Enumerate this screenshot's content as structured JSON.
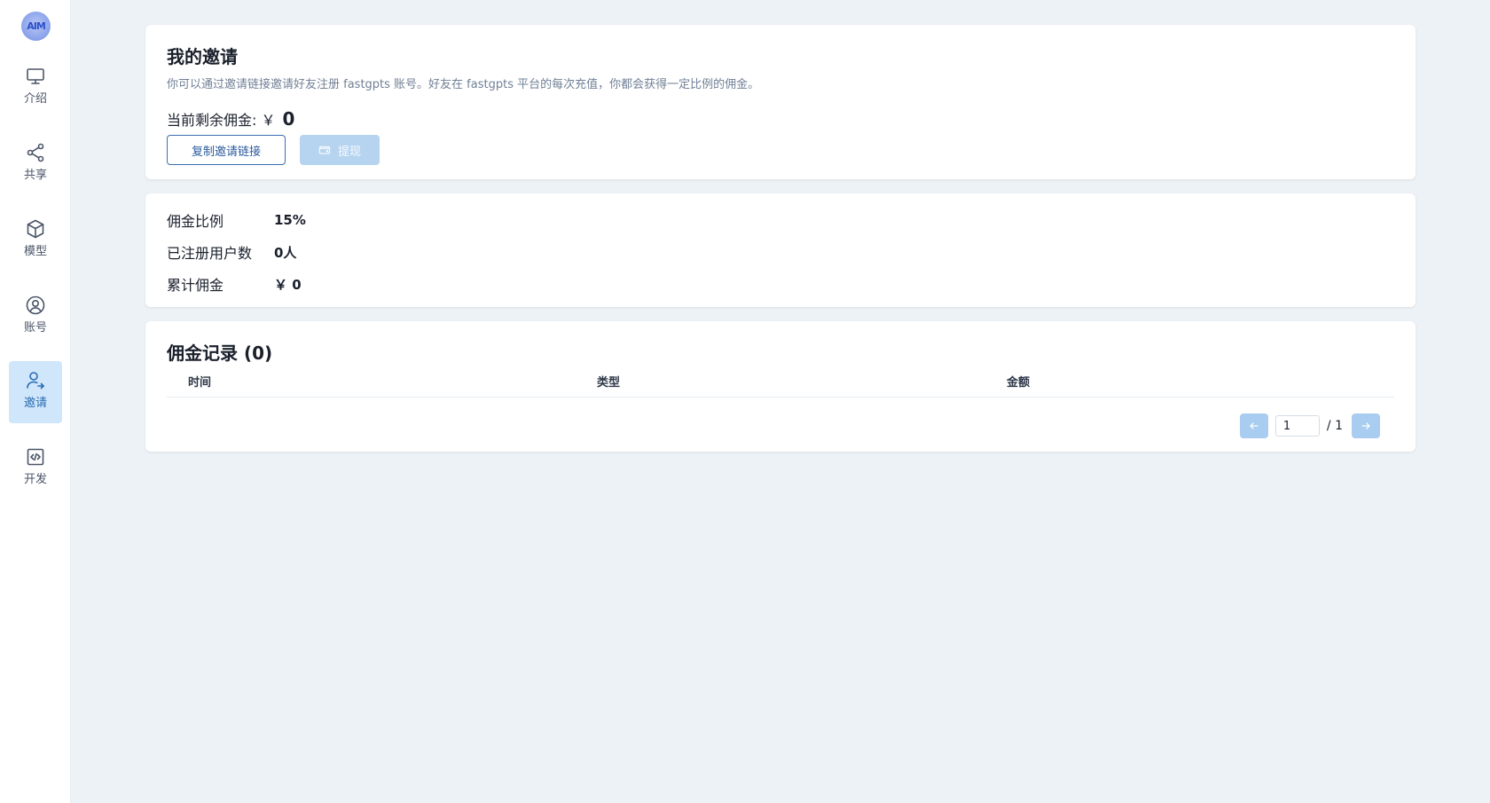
{
  "sidebar": {
    "logo_text": "AIM",
    "items": [
      {
        "label": "介绍",
        "icon": "monitor-icon"
      },
      {
        "label": "共享",
        "icon": "share-icon"
      },
      {
        "label": "模型",
        "icon": "cube-icon"
      },
      {
        "label": "账号",
        "icon": "user-circle-icon"
      },
      {
        "label": "邀请",
        "icon": "user-invite-icon",
        "active": true
      },
      {
        "label": "开发",
        "icon": "code-icon"
      }
    ]
  },
  "invite": {
    "title": "我的邀请",
    "description": "你可以通过邀请链接邀请好友注册 fastgpts 账号。好友在 fastgpts 平台的每次充值，你都会获得一定比例的佣金。",
    "balance_label": "当前剩余佣金: ￥",
    "balance_value": "0",
    "copy_button": "复制邀请链接",
    "withdraw_button": "提现"
  },
  "stats": [
    {
      "label": "佣金比例",
      "value": "15%"
    },
    {
      "label": "已注册用户数",
      "value": "0人"
    },
    {
      "label": "累计佣金",
      "value": "￥ 0"
    }
  ],
  "records": {
    "title": "佣金记录 (0)",
    "columns": [
      "时间",
      "类型",
      "金额"
    ],
    "page_value": "1",
    "page_total": "/ 1"
  },
  "colors": {
    "accent": "#2b6cb0",
    "active_bg": "#cfe6fb",
    "page_bg": "#edf2f7"
  }
}
